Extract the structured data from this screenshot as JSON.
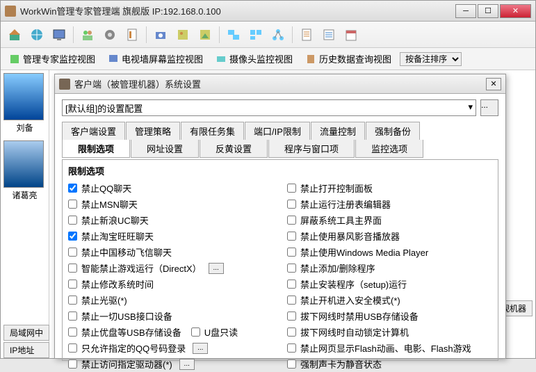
{
  "main": {
    "title": "WorkWin管理专家管理端  旗舰版 IP:192.168.0.100",
    "viewbar": {
      "v1": "管理专家监控视图",
      "v2": "电视墙屏幕监控视图",
      "v3": "摄像头监控视图",
      "v4": "历史数据查询视图",
      "sort_label": "按备注排序"
    },
    "thumbs": {
      "t1": "刘备",
      "t2": "诸葛亮"
    },
    "bottom": {
      "b1": "局域网中",
      "b2": "IP地址"
    },
    "right_btn": "监视机器"
  },
  "dialog": {
    "title": "客户端（被管理机器）系统设置",
    "config_select": "[默认组]的设置配置",
    "tabs_row1": [
      "客户端设置",
      "管理策略",
      "有限任务集",
      "端口/IP限制",
      "流量控制",
      "强制备份"
    ],
    "tabs_row2": [
      "限制选项",
      "网址设置",
      "反黄设置",
      "程序与窗口项",
      "监控选项"
    ],
    "tabs_row2_active": 0,
    "group_title": "限制选项",
    "left": [
      {
        "label": "禁止QQ聊天",
        "checked": true
      },
      {
        "label": "禁止MSN聊天",
        "checked": false
      },
      {
        "label": "禁止新浪UC聊天",
        "checked": false
      },
      {
        "label": "禁止淘宝旺旺聊天",
        "checked": true
      },
      {
        "label": "禁止中国移动飞信聊天",
        "checked": false
      },
      {
        "label": "智能禁止游戏运行（DirectX）",
        "checked": false,
        "more": true
      },
      {
        "label": "禁止修改系统时间",
        "checked": false
      },
      {
        "label": "禁止光驱(*)",
        "checked": false
      },
      {
        "label": "禁止一切USB接口设备",
        "checked": false
      },
      {
        "label": "禁止优盘等USB存储设备",
        "checked": false,
        "extra": "U盘只读"
      },
      {
        "label": "只允许指定的QQ号码登录",
        "checked": false,
        "more": true
      },
      {
        "label": "禁止访问指定驱动器(*)",
        "checked": false,
        "more": true
      }
    ],
    "right": [
      {
        "label": "禁止打开控制面板",
        "checked": false
      },
      {
        "label": "禁止运行注册表编辑器",
        "checked": false
      },
      {
        "label": "屏蔽系统工具主界面",
        "checked": false
      },
      {
        "label": "禁止使用暴风影音播放器",
        "checked": false
      },
      {
        "label": "禁止使用Windows Media Player",
        "checked": false
      },
      {
        "label": "禁止添加/删除程序",
        "checked": false
      },
      {
        "label": "禁止安装程序（setup)运行",
        "checked": false
      },
      {
        "label": "禁止开机进入安全模式(*)",
        "checked": false
      },
      {
        "label": "拔下网线时禁用USB存储设备",
        "checked": false
      },
      {
        "label": "拔下网线时自动锁定计算机",
        "checked": false
      },
      {
        "label": "禁止网页显示Flash动画、电影、Flash游戏",
        "checked": false
      },
      {
        "label": "强制声卡为静音状态",
        "checked": false
      }
    ]
  }
}
